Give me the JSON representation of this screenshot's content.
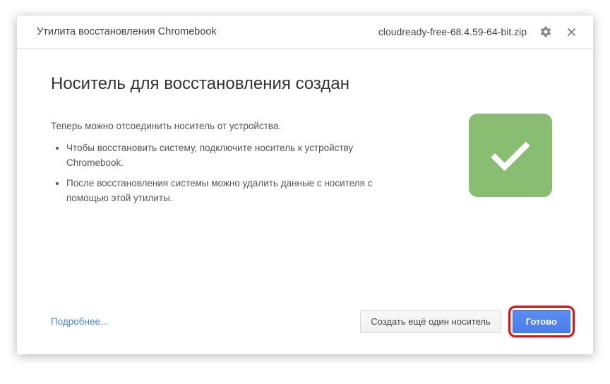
{
  "header": {
    "title": "Утилита восстановления Chromebook",
    "filename": "cloudready-free-68.4.59-64-bit.zip"
  },
  "content": {
    "title": "Носитель для восстановления создан",
    "subtitle": "Теперь можно отсоединить носитель от устройства.",
    "bullets": [
      "Чтобы восстановить систему, подключите носитель к устройству Chromebook.",
      "После восстановления системы можно удалить данные с носителя с помощью этой утилиты."
    ]
  },
  "footer": {
    "more_link": "Подробнее...",
    "create_another": "Создать ещё один носитель",
    "done": "Готово"
  }
}
